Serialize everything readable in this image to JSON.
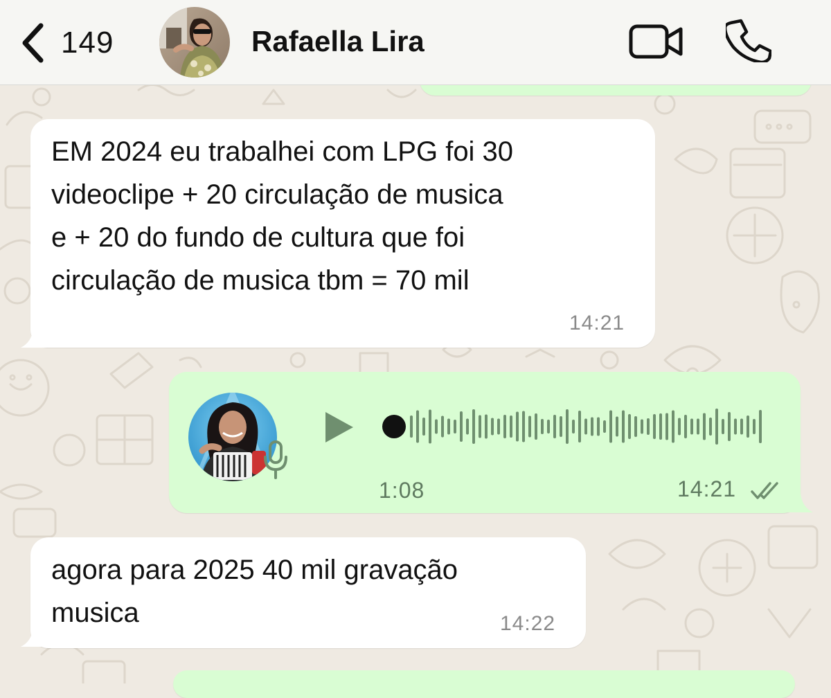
{
  "header": {
    "back_count": "149",
    "contact_name": "Rafaella Lira",
    "icons": [
      "chevron-left-icon",
      "video-camera-icon",
      "phone-icon"
    ]
  },
  "messages": [
    {
      "direction": "incoming",
      "type": "text",
      "text": "EM 2024 eu trabalhei com LPG  foi 30\nvideoclipe + 20 circulação de musica\ne + 20 do fundo de cultura que foi\ncirculação de musica tbm = 70 mil",
      "time": "14:21"
    },
    {
      "direction": "outgoing",
      "type": "voice",
      "duration": "1:08",
      "time": "14:21",
      "status": "read",
      "playback_progress": 0
    },
    {
      "direction": "incoming",
      "type": "text",
      "text": "agora para 2025 40 mil gravação\nmusica",
      "time": "14:22"
    }
  ],
  "colors": {
    "incoming_bubble": "#ffffff",
    "outgoing_bubble": "#d9fdd3",
    "chat_background": "#efeae2",
    "header_background": "#f6f6f3",
    "voice_accent": "#6f8f6f"
  }
}
